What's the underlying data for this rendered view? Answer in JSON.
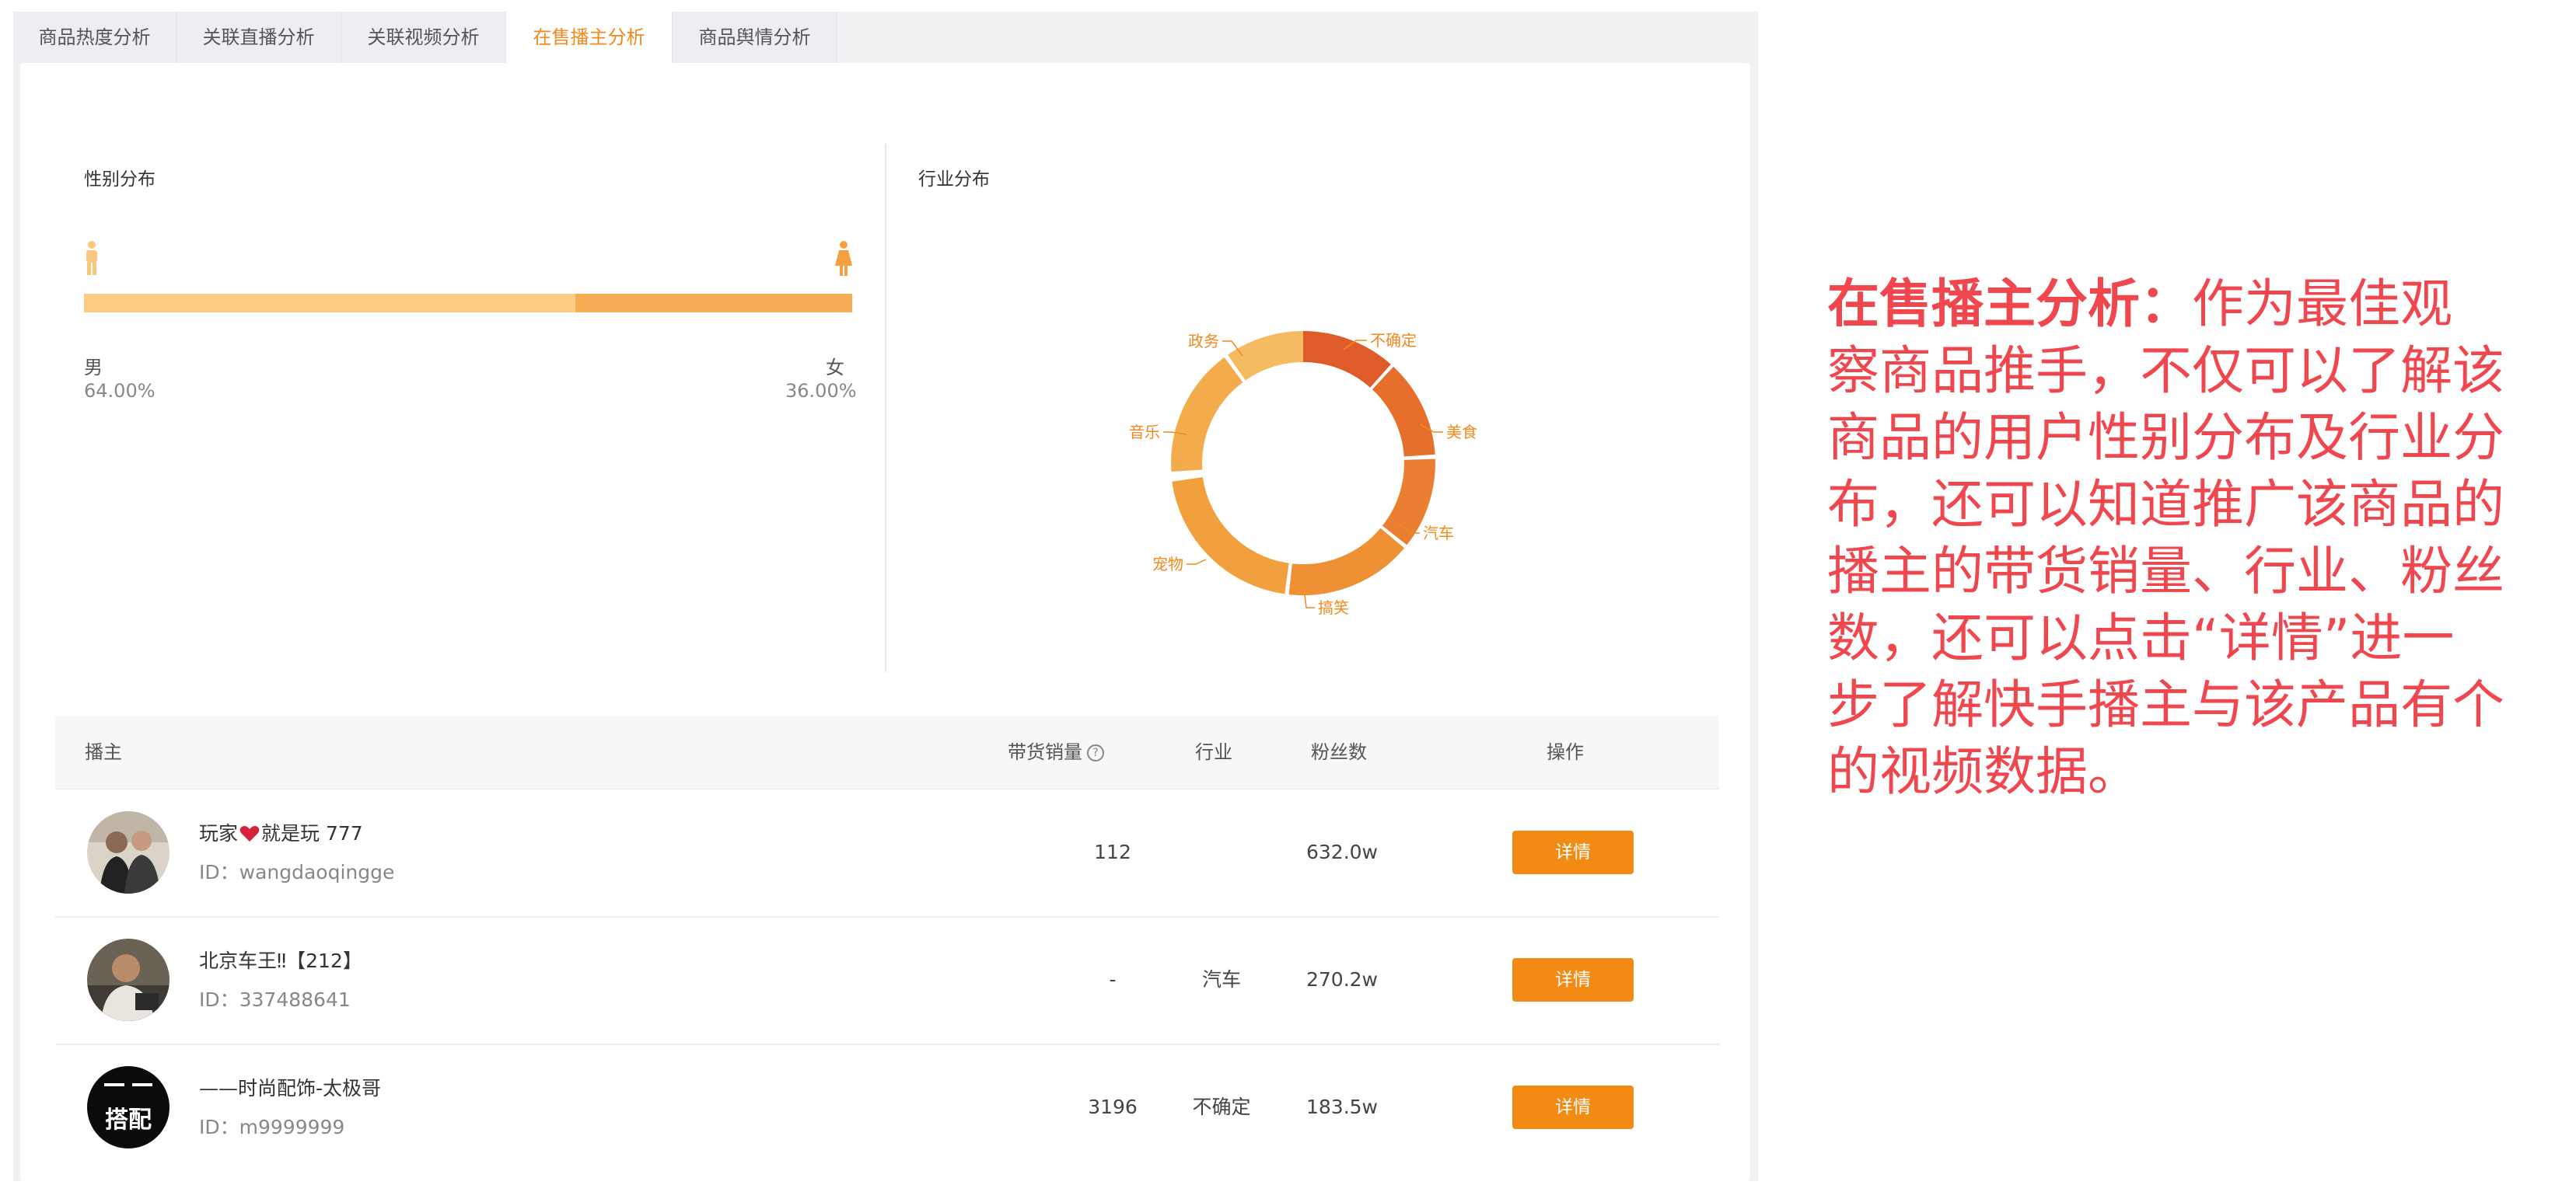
{
  "tabs": [
    {
      "label": "商品热度分析",
      "active": false
    },
    {
      "label": "关联直播分析",
      "active": false
    },
    {
      "label": "关联视频分析",
      "active": false
    },
    {
      "label": "在售播主分析",
      "active": true
    },
    {
      "label": "商品舆情分析",
      "active": false
    }
  ],
  "gender": {
    "title": "性别分布",
    "male_label": "男",
    "male_value": "64.00%",
    "male_fraction": 0.64,
    "female_label": "女",
    "female_value": "36.00%"
  },
  "industry": {
    "title": "行业分布",
    "labels": [
      "不确定",
      "美食",
      "汽车",
      "搞笑",
      "宠物",
      "音乐",
      "政务"
    ]
  },
  "table": {
    "headers": {
      "streamer": "播主",
      "sales": "带货销量",
      "sales_help": "?",
      "industry": "行业",
      "fans": "粉丝数",
      "action": "操作"
    },
    "rows": [
      {
        "name_part1": "玩家",
        "name_part2": "就是玩 777",
        "id": "ID：wangdaoqingge",
        "sales": "112",
        "industry": "",
        "fans": "632.0w",
        "action": "详情"
      },
      {
        "name": "北京车王‼【212】",
        "id": "ID：337488641",
        "sales": "-",
        "industry": "汽车",
        "fans": "270.2w",
        "action": "详情"
      },
      {
        "name": "——时尚配饰-太极哥",
        "id": "ID：m9999999",
        "sales": "3196",
        "industry": "不确定",
        "fans": "183.5w",
        "action": "详情"
      }
    ],
    "avatar3_text": "搭配"
  },
  "description": {
    "title": "在售播主分析：",
    "line1": "作为最佳观",
    "line2": "察商品推手，不仅可以了解该",
    "line3": "商品的用户性别分布及行业分",
    "line4": "布，还可以知道推广该商品的",
    "line5": "播主的带货销量、行业、粉丝",
    "line6": "数，还可以点击“详情”进一",
    "line7": "步了解快手播主与该产品有个",
    "line8": "的视频数据。"
  },
  "colors": {
    "accent": "#f28a14",
    "description_red": "#f0474f",
    "male_bar": "#fdcb83",
    "female_bar": "#f6ad56"
  }
}
